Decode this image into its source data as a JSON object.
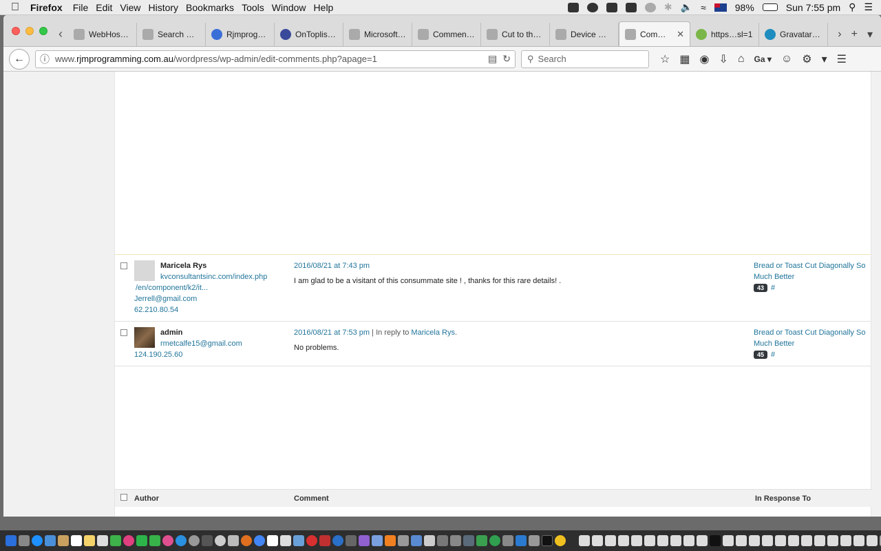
{
  "menubar": {
    "app": "Firefox",
    "items": [
      "File",
      "Edit",
      "View",
      "History",
      "Bookmarks",
      "Tools",
      "Window",
      "Help"
    ],
    "battery": "98%",
    "clock": "Sun 7:55 pm"
  },
  "tabs": [
    {
      "label": "WebHost…",
      "icon": "page-icon"
    },
    {
      "label": "Search C…",
      "icon": "page-icon"
    },
    {
      "label": "Rjmprogr…",
      "icon": "letter-a-icon"
    },
    {
      "label": "OnToplist…",
      "icon": "globe-icon"
    },
    {
      "label": "Microsoft…",
      "icon": "page-icon"
    },
    {
      "label": "Commen…",
      "icon": "page-icon"
    },
    {
      "label": "Cut to th…",
      "icon": "page-icon"
    },
    {
      "label": "Device M…",
      "icon": "page-icon"
    },
    {
      "label": "Com…",
      "icon": "page-icon",
      "active": true
    },
    {
      "label": "https…sl=1",
      "icon": "leaf-icon"
    },
    {
      "label": "Gravatar …",
      "icon": "gravatar-icon"
    }
  ],
  "nav": {
    "url_prefix": "www.",
    "url_host": "rjmprogramming.com.au",
    "url_path": "/wordpress/wp-admin/edit-comments.php?apage=1",
    "search_placeholder": "Search",
    "profile_label": "Ga"
  },
  "comments": [
    {
      "author": "Maricela Rys",
      "url_line1": "kvconsultantsinc.com/index.php",
      "url_line2": "/en/component/k2/it...",
      "email": "Jerrell@gmail.com",
      "ip": "62.210.80.54",
      "date": "2016/08/21 at 7:43 pm",
      "reply_prefix": "",
      "reply_to": "",
      "text": "I am glad to be a visitant of this consummate site ! , thanks for this rare details! .",
      "response_title": "Bread or Toast Cut Diagonally So Much Better",
      "count": "43",
      "hash": "#"
    },
    {
      "author": "admin",
      "url_line1": "rmetcalfe15@gmail.com",
      "url_line2": "",
      "email": "",
      "ip": "124.190.25.60",
      "date": "2016/08/21 at 7:53 pm",
      "reply_prefix": " | In reply to ",
      "reply_to": "Maricela Rys",
      "text": "No problems.",
      "response_title": "Bread or Toast Cut Diagonally So Much Better",
      "count": "45",
      "hash": "#"
    }
  ],
  "table_footer": {
    "author": "Author",
    "comment": "Comment",
    "in_response_to": "In Response To"
  }
}
